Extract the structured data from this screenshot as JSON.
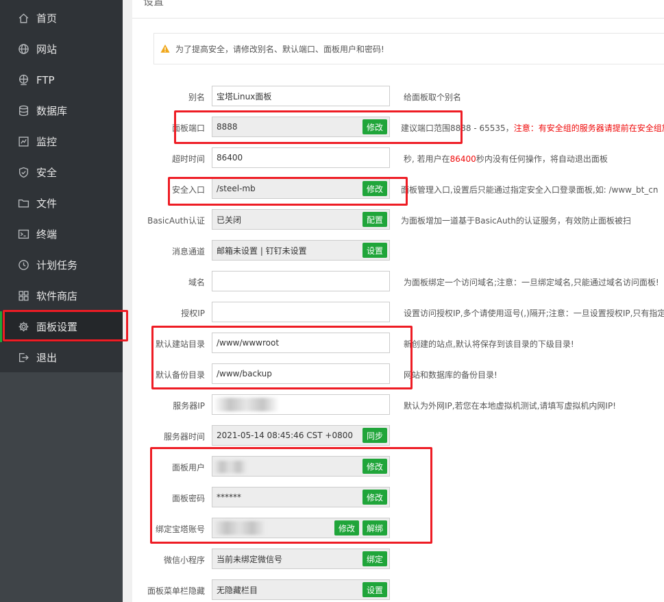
{
  "sidebar": {
    "items": [
      {
        "label": "首页",
        "icon": "home-icon"
      },
      {
        "label": "网站",
        "icon": "globe-icon"
      },
      {
        "label": "FTP",
        "icon": "ftp-globe-icon"
      },
      {
        "label": "数据库",
        "icon": "database-icon"
      },
      {
        "label": "监控",
        "icon": "monitor-icon"
      },
      {
        "label": "安全",
        "icon": "shield-icon"
      },
      {
        "label": "文件",
        "icon": "folder-icon"
      },
      {
        "label": "终端",
        "icon": "terminal-icon"
      },
      {
        "label": "计划任务",
        "icon": "schedule-icon"
      },
      {
        "label": "软件商店",
        "icon": "apps-icon"
      },
      {
        "label": "面板设置",
        "icon": "gear-icon"
      },
      {
        "label": "退出",
        "icon": "logout-icon"
      }
    ],
    "active_index": 10
  },
  "page": {
    "title": "设置",
    "alert": "为了提高安全，请修改别名、默认端口、面板用户和密码!"
  },
  "settings": {
    "alias": {
      "label": "别名",
      "value": "宝塔Linux面板",
      "hint": "给面板取个别名"
    },
    "port": {
      "label": "面板端口",
      "value": "8888",
      "button": "修改",
      "hint_prefix": "建议端口范围8888 - 65535，",
      "hint_warning": "注意：有安全组的服务器请提前在安全组放"
    },
    "timeout": {
      "label": "超时时间",
      "value": "86400",
      "hint_prefix": "秒, 若用户在",
      "hint_value": "86400",
      "hint_suffix": "秒内没有任何操作，将自动退出面板"
    },
    "entrance": {
      "label": "安全入口",
      "value": "/steel-mb",
      "button": "修改",
      "hint": "面板管理入口,设置后只能通过指定安全入口登录面板,如: /www_bt_cn"
    },
    "basicauth": {
      "label": "BasicAuth认证",
      "value": "已关闭",
      "button": "配置",
      "hint": "为面板增加一道基于BasicAuth的认证服务，有效防止面板被扫"
    },
    "message": {
      "label": "消息通道",
      "value": "邮箱未设置 | 钉钉未设置",
      "button": "设置"
    },
    "domain": {
      "label": "域名",
      "value": "",
      "hint": "为面板绑定一个访问域名;注意：一旦绑定域名,只能通过域名访问面板!"
    },
    "auth_ip": {
      "label": "授权IP",
      "value": "",
      "hint": "设置访问授权IP,多个请使用逗号(,)隔开;注意：一旦设置授权IP,只有指定I"
    },
    "site_dir": {
      "label": "默认建站目录",
      "value": "/www/wwwroot",
      "hint": "新创建的站点,默认将保存到该目录的下级目录!"
    },
    "backup_dir": {
      "label": "默认备份目录",
      "value": "/www/backup",
      "hint": "网站和数据库的备份目录!"
    },
    "server_ip": {
      "label": "服务器IP",
      "value": "",
      "hint": "默认为外网IP,若您在本地虚拟机测试,请填写虚拟机内网IP!"
    },
    "server_time": {
      "label": "服务器时间",
      "value": "2021-05-14 08:45:46 CST +0800",
      "button": "同步"
    },
    "panel_user": {
      "label": "面板用户",
      "value": "",
      "button": "修改"
    },
    "panel_password": {
      "label": "面板密码",
      "value": "******",
      "button": "修改"
    },
    "bt_account": {
      "label": "绑定宝塔账号",
      "value": "",
      "button": "修改",
      "button2": "解绑"
    },
    "wechat": {
      "label": "微信小程序",
      "value": "当前未绑定微信号",
      "button": "绑定"
    },
    "menu_hide": {
      "label": "面板菜单栏隐藏",
      "value": "无隐藏栏目",
      "button": "设置"
    }
  },
  "colors": {
    "accent": "#20a53a",
    "highlight": "#ee1c24",
    "sidebar_bg": "#2f3337",
    "warning_text": "#ef0808"
  }
}
